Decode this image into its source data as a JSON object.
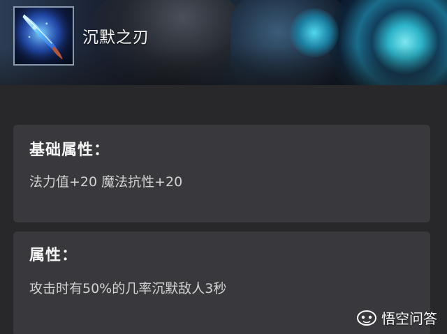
{
  "header": {
    "item_name": "沉默之刃",
    "item_icon": "blade-icon"
  },
  "sections": [
    {
      "title": "基础属性：",
      "text": "法力值+20 魔法抗性+20"
    },
    {
      "title": "属性：",
      "text": "攻击时有50%的几率沉默敌人3秒"
    }
  ],
  "watermark": {
    "label": "悟空问答",
    "icon": "wukong-logo-icon"
  },
  "colors": {
    "background": "#28282b",
    "card": "#39393d",
    "icon_border": "#8a9bb0"
  }
}
